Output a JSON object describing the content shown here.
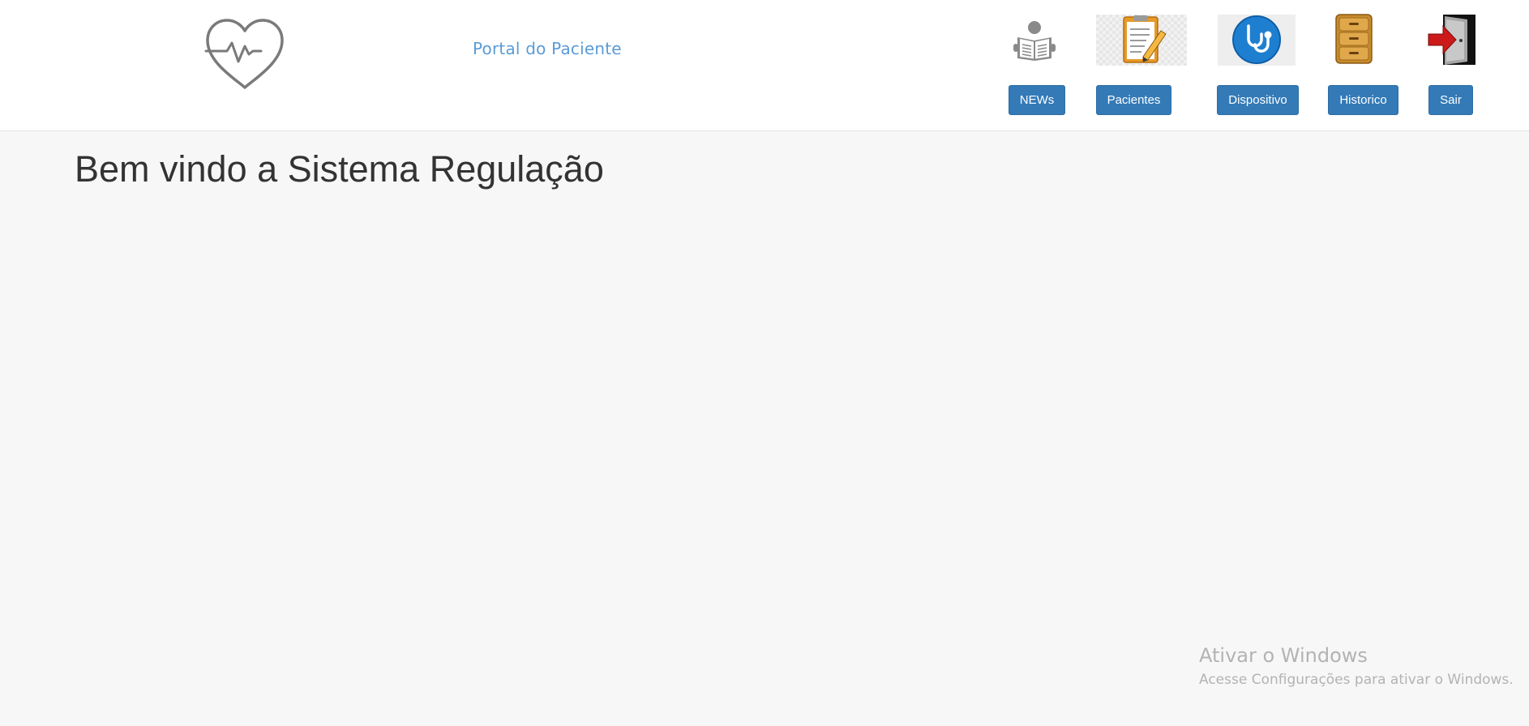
{
  "header": {
    "portal_title": "Portal do Paciente",
    "logo_icon": "heart-pulse-icon",
    "nav": [
      {
        "label": "NEWs",
        "icon": "newspaper-reader-icon"
      },
      {
        "label": "Pacientes",
        "icon": "clipboard-icon"
      },
      {
        "label": "Dispositivo",
        "icon": "stethoscope-icon"
      },
      {
        "label": "Historico",
        "icon": "file-cabinet-icon"
      },
      {
        "label": "Sair",
        "icon": "exit-door-icon"
      }
    ]
  },
  "main": {
    "welcome_title": "Bem vindo a Sistema Regulação"
  },
  "watermark": {
    "title": "Ativar o Windows",
    "subtitle": "Acesse Configurações para ativar o Windows."
  },
  "colors": {
    "button_bg": "#337ab7",
    "portal_title": "#5b9bd5",
    "page_bg": "#f7f7f7"
  }
}
